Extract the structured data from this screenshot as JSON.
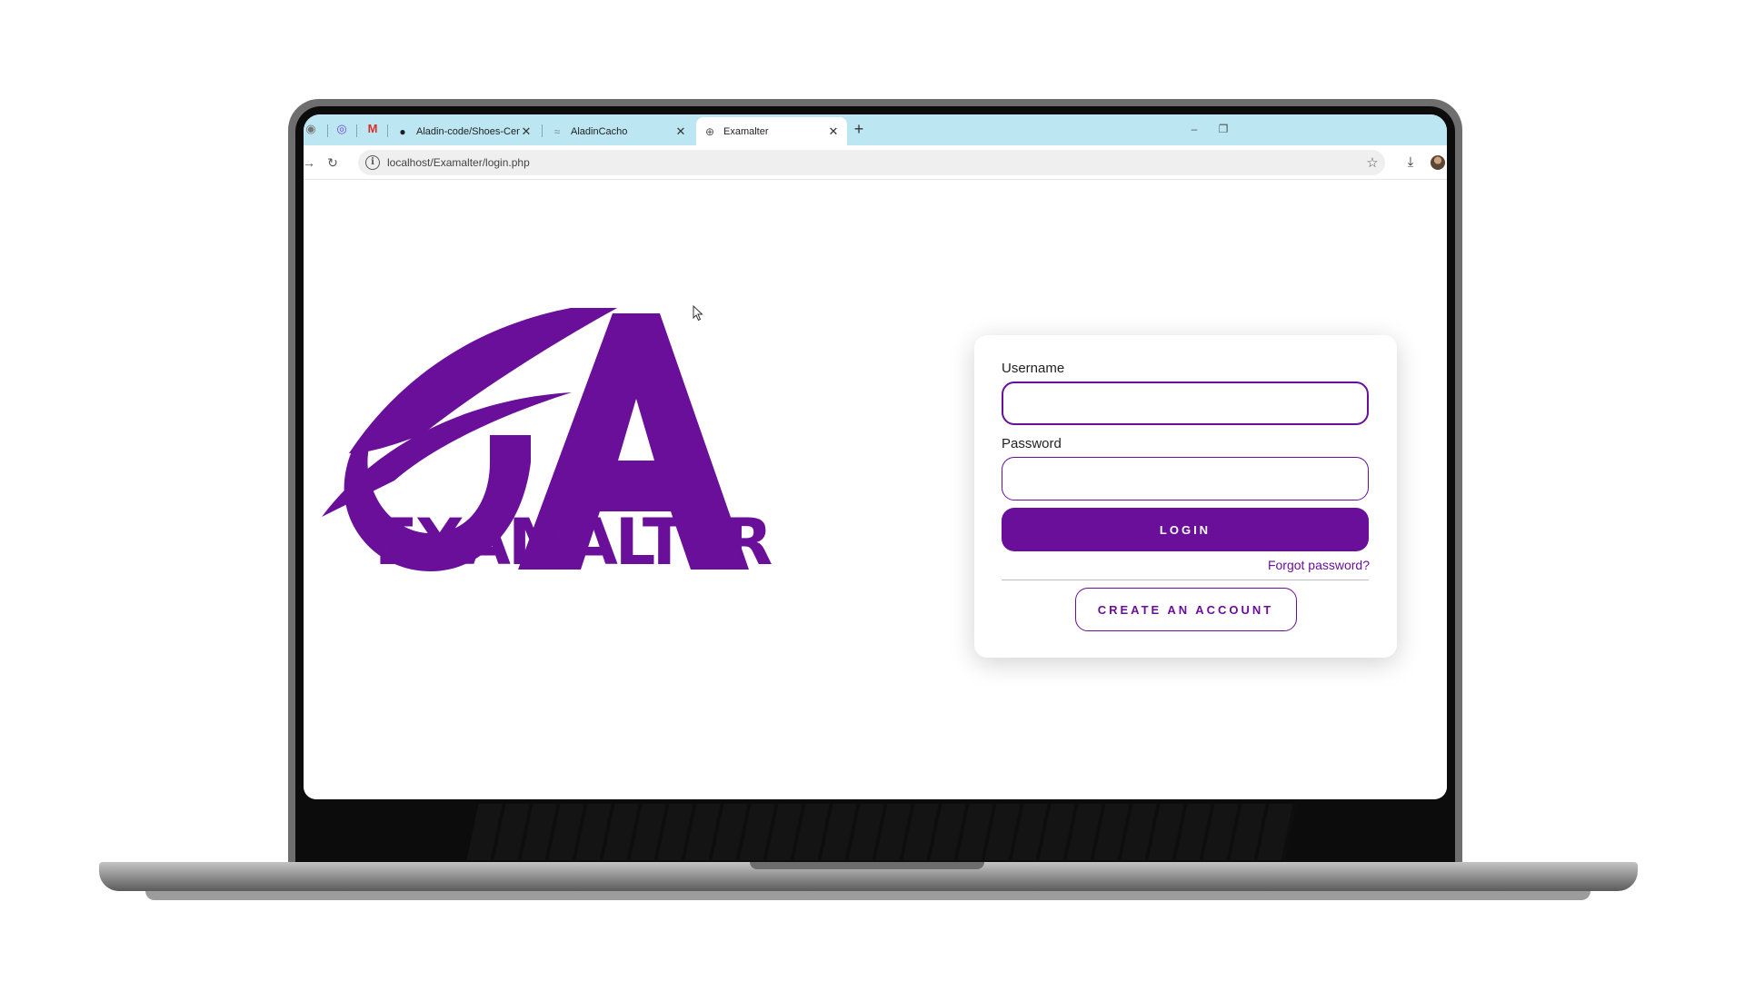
{
  "browser": {
    "tabs": [
      {
        "title": "Aladin-code/Shoes-Center---E",
        "favicon": "github-icon",
        "active": false
      },
      {
        "title": "AladinCacho",
        "favicon": "page-icon",
        "active": false
      },
      {
        "title": "Examalter",
        "favicon": "globe-icon",
        "active": true
      }
    ],
    "new_tab_label": "+",
    "url": "localhost/Examalter/login.php"
  },
  "logo": {
    "wordmark": "EXAMALTER",
    "color": "#6a0f9a"
  },
  "login_form": {
    "username_label": "Username",
    "username_value": "",
    "password_label": "Password",
    "password_value": "",
    "login_button": "LOGIN",
    "forgot_link": "Forgot password?",
    "create_account_button": "CREATE AN ACCOUNT"
  },
  "colors": {
    "accent": "#6a0f9a",
    "tabbar": "#bde6f3"
  }
}
